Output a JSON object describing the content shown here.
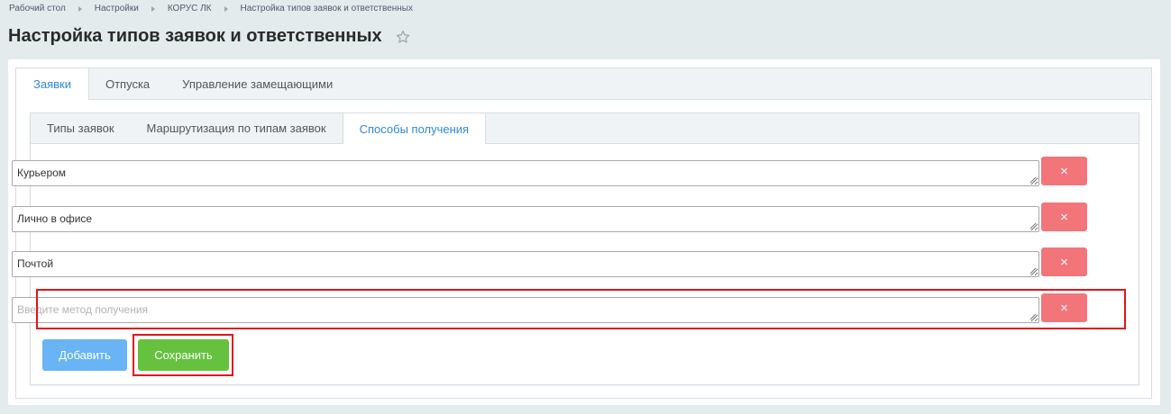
{
  "breadcrumb": {
    "items": [
      "Рабочий стол",
      "Настройки",
      "КОРУС ЛК",
      "Настройка типов заявок и ответственных"
    ]
  },
  "page": {
    "title": "Настройка типов заявок и ответственных"
  },
  "main_tabs": [
    {
      "label": "Заявки",
      "active": true
    },
    {
      "label": "Отпуска",
      "active": false
    },
    {
      "label": "Управление замещающими",
      "active": false
    }
  ],
  "sub_tabs": [
    {
      "label": "Типы заявок",
      "active": false
    },
    {
      "label": "Маршрутизация по типам заявок",
      "active": false
    },
    {
      "label": "Способы получения",
      "active": true
    }
  ],
  "methods": [
    {
      "value": "Курьером"
    },
    {
      "value": "Лично в офисе"
    },
    {
      "value": "Почтой"
    },
    {
      "value": "",
      "placeholder": "Введите метод получения"
    }
  ],
  "buttons": {
    "delete_label": "×",
    "add_label": "Добавить",
    "save_label": "Сохранить"
  },
  "colors": {
    "accent": "#2d89d8",
    "delete": "#f2757a",
    "add": "#69b4f5",
    "save": "#66c13f",
    "highlight": "#e0141b"
  },
  "icons": {
    "favorite": "star-icon",
    "delete": "close-icon"
  }
}
